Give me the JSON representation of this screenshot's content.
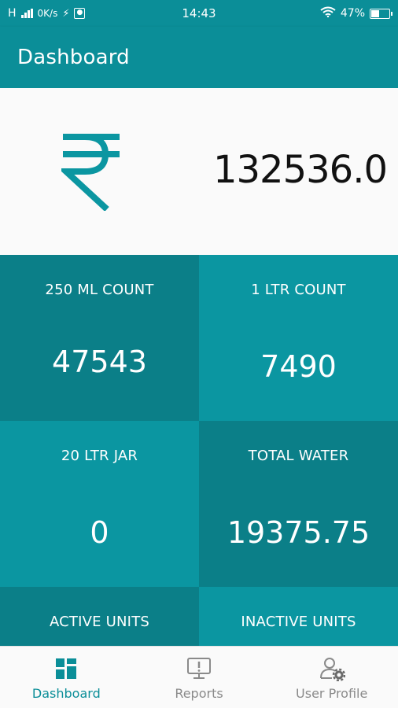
{
  "status_bar": {
    "network_type": "H",
    "speed": "0K/s",
    "time": "14:43",
    "battery_percent": "47%",
    "battery_level": 0.47
  },
  "app_bar": {
    "title": "Dashboard"
  },
  "summary": {
    "amount": "132536.0",
    "icon": "rupee-icon"
  },
  "tiles": [
    {
      "label": "250 ML COUNT",
      "value": "47543",
      "color": "#0b7f88"
    },
    {
      "label": "1 LTR COUNT",
      "value": "7490",
      "color": "#0b96a1"
    },
    {
      "label": "20 LTR JAR",
      "value": "0",
      "color": "#0b96a1"
    },
    {
      "label": "TOTAL WATER",
      "value": "19375.75",
      "color": "#0b7f88"
    },
    {
      "label": "ACTIVE UNITS",
      "value": "",
      "color": "#0b7f88"
    },
    {
      "label": "INACTIVE UNITS",
      "value": "",
      "color": "#0b96a1"
    }
  ],
  "bottom_nav": {
    "items": [
      {
        "label": "Dashboard",
        "icon": "dashboard-grid-icon",
        "active": true
      },
      {
        "label": "Reports",
        "icon": "monitor-alert-icon",
        "active": false
      },
      {
        "label": "User Profile",
        "icon": "user-settings-icon",
        "active": false
      }
    ],
    "active_color": "#0b8e98",
    "inactive_color": "#8a8a8a"
  },
  "colors": {
    "primary": "#0b8e98",
    "amount_text": "#111111"
  }
}
